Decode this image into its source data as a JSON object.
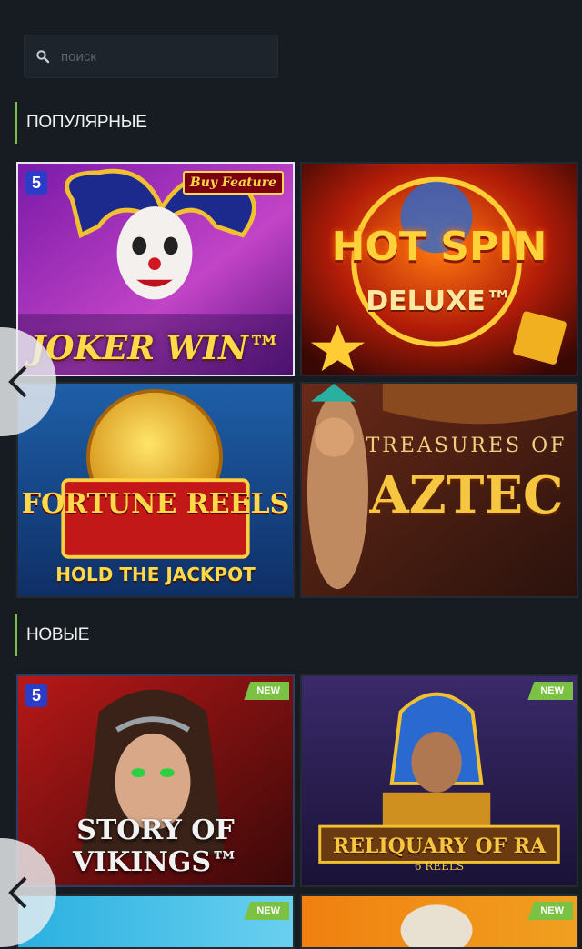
{
  "search": {
    "placeholder": "поиск",
    "icon": "search-icon"
  },
  "sections": [
    {
      "title": "ПОПУЛЯРНЫЕ",
      "games": [
        {
          "name": "JOKER WIN™",
          "badge": "Buy Feature",
          "provider_logo": "5"
        },
        {
          "name": "HOT SPIN",
          "subtitle": "DELUXE™"
        },
        {
          "name": "FORTUNE REELS",
          "subtitle": "HOLD THE JACKPOT"
        },
        {
          "name": "AZTEC",
          "subtitle": "TREASURES OF"
        }
      ]
    },
    {
      "title": "НОВЫЕ",
      "games": [
        {
          "name": "STORY OF VIKINGS™",
          "badge": "NEW",
          "provider_logo": "5"
        },
        {
          "name": "RELIQUARY OF RA",
          "subtitle": "6 REELS",
          "badge": "NEW"
        },
        {
          "name": "",
          "badge": "NEW"
        },
        {
          "name": "",
          "badge": "NEW"
        }
      ]
    }
  ],
  "colors": {
    "background": "#171c22",
    "accent": "#79c141",
    "card_border": "#232a31"
  }
}
